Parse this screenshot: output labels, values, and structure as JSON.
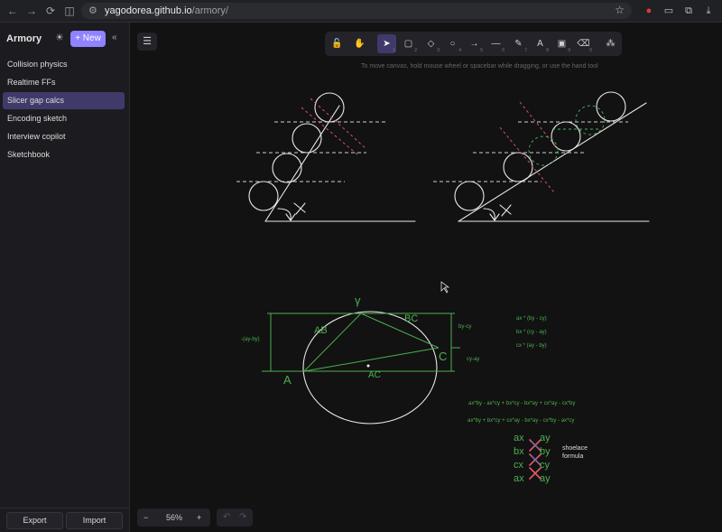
{
  "browser": {
    "url_host": "yagodorea.github.io",
    "url_path": "/armory/"
  },
  "sidebar": {
    "title": "Armory",
    "new_label": "+ New",
    "documents": [
      {
        "label": "Collision physics"
      },
      {
        "label": "Realtime FFs"
      },
      {
        "label": "Slicer gap calcs",
        "active": true
      },
      {
        "label": "Encoding sketch"
      },
      {
        "label": "Interview copilot"
      },
      {
        "label": "Sketchbook"
      }
    ],
    "export_label": "Export",
    "import_label": "Import"
  },
  "toolbar": {
    "tools": [
      {
        "name": "lock-icon",
        "glyph": "🔓",
        "key": ""
      },
      {
        "name": "hand-icon",
        "glyph": "✋",
        "key": ""
      },
      {
        "name": "selection-icon",
        "glyph": "➤",
        "key": "1",
        "active": true
      },
      {
        "name": "rectangle-icon",
        "glyph": "▢",
        "key": "2"
      },
      {
        "name": "diamond-icon",
        "glyph": "◇",
        "key": "3"
      },
      {
        "name": "ellipse-icon",
        "glyph": "○",
        "key": "4"
      },
      {
        "name": "arrow-icon",
        "glyph": "→",
        "key": "5"
      },
      {
        "name": "line-icon",
        "glyph": "—",
        "key": "6"
      },
      {
        "name": "pencil-icon",
        "glyph": "✎",
        "key": "7"
      },
      {
        "name": "text-icon",
        "glyph": "A",
        "key": "8"
      },
      {
        "name": "image-icon",
        "glyph": "▣",
        "key": "9"
      },
      {
        "name": "eraser-icon",
        "glyph": "⌫",
        "key": "0"
      },
      {
        "name": "extra-tools-icon",
        "glyph": "⁂",
        "key": ""
      }
    ]
  },
  "canvas": {
    "hint": "To move canvas, hold mouse wheel or spacebar while dragging, or use the hand tool",
    "zoom": "56%",
    "sketch": {
      "labels": {
        "gamma": "γ",
        "ab": "AB",
        "bc": "BC",
        "a": "A",
        "c": "C",
        "ac": "AC",
        "height_left": "-(ay-by)",
        "height_right_top": "by-cy",
        "height_right_bottom": "cy-ay"
      },
      "cross_terms": [
        "ax * (by - cy)",
        "bx * (cy - ay)",
        "cx * (ay - by)"
      ],
      "expansion_1": "ax*by - ax*cy + bx*cy - bx*ay + cx*ay - cx*by",
      "expansion_2": "ax*by + bx*cy + cx*ay - bx*ay - cx*by - ax*cy",
      "shoelace_rows": [
        {
          "x": "ax",
          "y": "ay"
        },
        {
          "x": "bx",
          "y": "by"
        },
        {
          "x": "cx",
          "y": "cy"
        },
        {
          "x": "ax",
          "y": "ay"
        }
      ],
      "shoelace_note_1": "shoelace",
      "shoelace_note_2": "formula"
    }
  }
}
